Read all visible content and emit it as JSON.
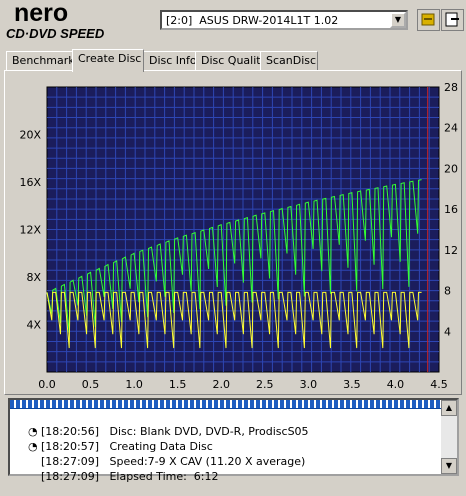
{
  "app": {
    "logo_primary": "nero",
    "logo_secondary": "CD·DVD SPEED",
    "drive": "[2:0]  ASUS DRW-2014L1T 1.02"
  },
  "tabs": [
    {
      "label": "Benchmark"
    },
    {
      "label": "Create Disc"
    },
    {
      "label": "Disc Info"
    },
    {
      "label": "Disc Quality"
    },
    {
      "label": "ScanDisc"
    }
  ],
  "active_tab": "Create Disc",
  "chart_data": {
    "type": "line",
    "xlim": [
      0,
      4.5
    ],
    "ylim_left": [
      0,
      24
    ],
    "ylim_right": [
      0,
      28
    ],
    "x_ticks": [
      "0.0",
      "0.5",
      "1.0",
      "1.5",
      "2.0",
      "2.5",
      "3.0",
      "3.5",
      "4.0",
      "4.5"
    ],
    "y_left_ticks": [
      "4X",
      "8X",
      "12X",
      "16X",
      "20X"
    ],
    "y_right_ticks": [
      "4",
      "8",
      "12",
      "16",
      "20",
      "24",
      "28"
    ],
    "background": "#1b1d5c",
    "grid_color": "#2e46b4",
    "series": [
      {
        "color": "#33ff33",
        "x": [
          0.0,
          0.5,
          1.0,
          1.5,
          2.0,
          2.5,
          3.0,
          3.5,
          4.0,
          4.3
        ],
        "y": [
          6.7,
          8.4,
          10.0,
          11.3,
          12.4,
          13.4,
          14.3,
          15.1,
          15.8,
          16.2
        ]
      },
      {
        "color": "#ffff33",
        "x": [
          0.0,
          0.5,
          1.0,
          1.5,
          2.0,
          2.5,
          3.0,
          3.5,
          4.0,
          4.3
        ],
        "y": [
          6.7,
          6.7,
          6.7,
          6.7,
          6.7,
          6.7,
          6.7,
          6.7,
          6.7,
          6.7
        ]
      }
    ],
    "marker_x": 4.37,
    "marker_color": "#cc2222"
  },
  "log": [
    {
      "icon": "disc-icon",
      "text": "[18:20:56]   Disc: Blank DVD, DVD-R, ProdiscS05"
    },
    {
      "icon": "disc-icon",
      "text": "[18:20:57]   Creating Data Disc"
    },
    {
      "icon": "",
      "text": "[18:27:09]   Speed:7-9 X CAV (11.20 X average)"
    },
    {
      "icon": "",
      "text": "[18:27:09]   Elapsed Time:  6:12"
    }
  ]
}
